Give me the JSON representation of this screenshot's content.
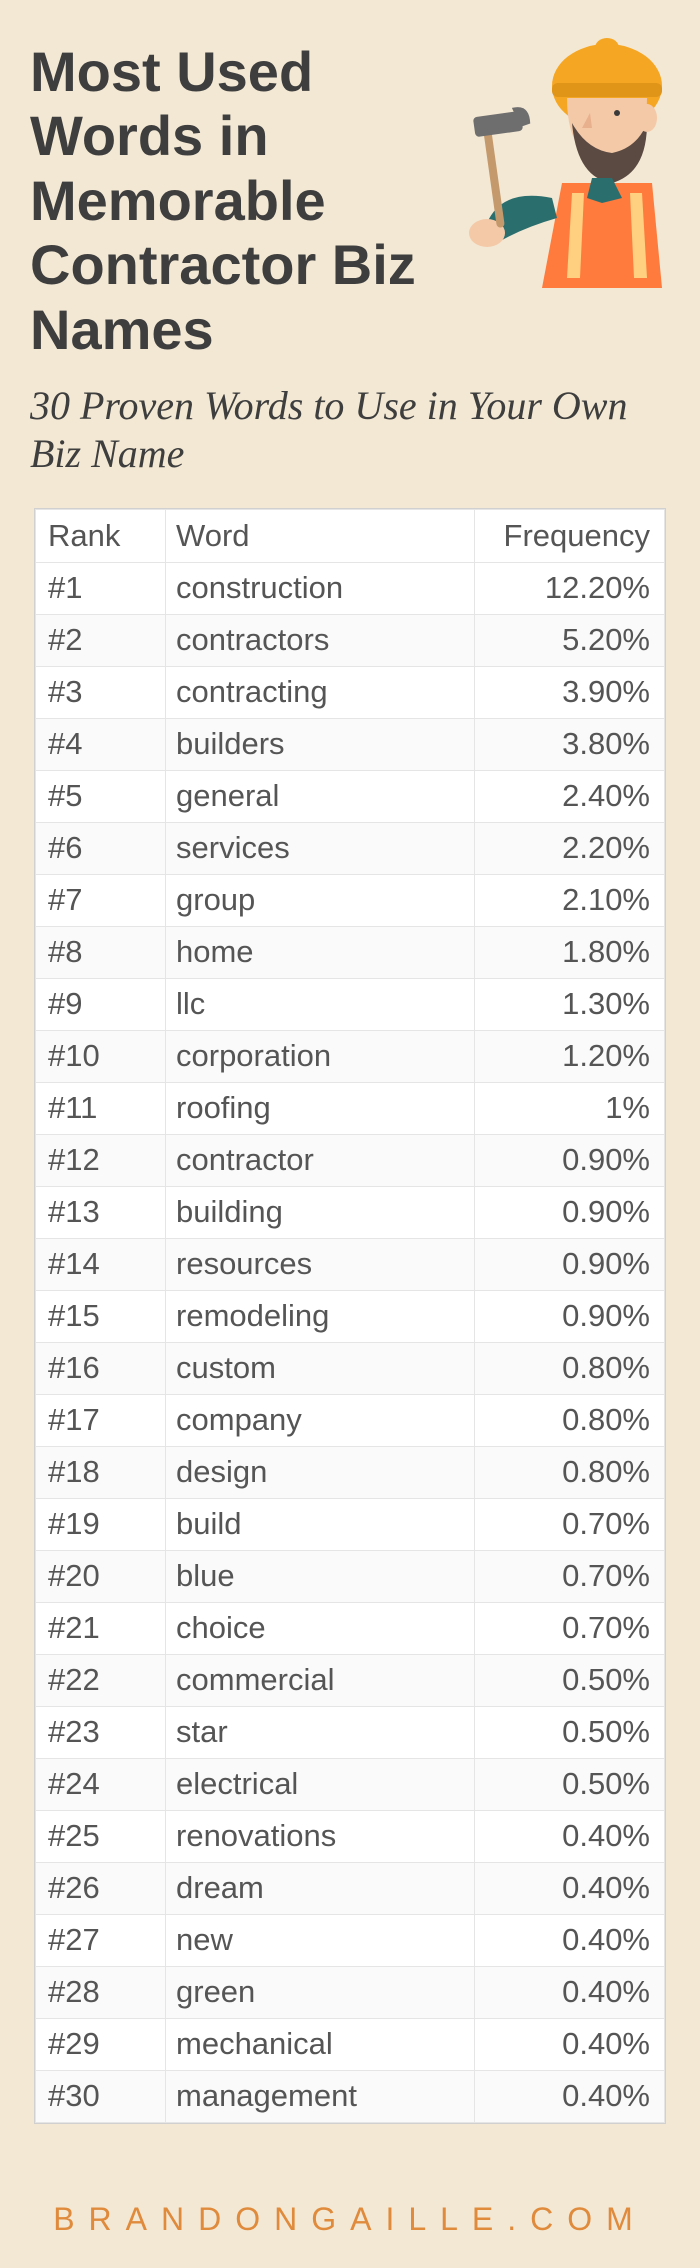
{
  "header": {
    "title": "Most Used Words in Memorable Contractor Biz Names",
    "subtitle": "30 Proven Words to Use in Your Own Biz Name"
  },
  "chart_data": {
    "type": "table",
    "columns": [
      "Rank",
      "Word",
      "Frequency"
    ],
    "rows": [
      {
        "rank": "#1",
        "word": "construction",
        "frequency": "12.20%"
      },
      {
        "rank": "#2",
        "word": "contractors",
        "frequency": "5.20%"
      },
      {
        "rank": "#3",
        "word": "contracting",
        "frequency": "3.90%"
      },
      {
        "rank": "#4",
        "word": "builders",
        "frequency": "3.80%"
      },
      {
        "rank": "#5",
        "word": "general",
        "frequency": "2.40%"
      },
      {
        "rank": "#6",
        "word": "services",
        "frequency": "2.20%"
      },
      {
        "rank": "#7",
        "word": "group",
        "frequency": "2.10%"
      },
      {
        "rank": "#8",
        "word": "home",
        "frequency": "1.80%"
      },
      {
        "rank": "#9",
        "word": "llc",
        "frequency": "1.30%"
      },
      {
        "rank": "#10",
        "word": "corporation",
        "frequency": "1.20%"
      },
      {
        "rank": "#11",
        "word": "roofing",
        "frequency": "1%"
      },
      {
        "rank": "#12",
        "word": "contractor",
        "frequency": "0.90%"
      },
      {
        "rank": "#13",
        "word": "building",
        "frequency": "0.90%"
      },
      {
        "rank": "#14",
        "word": "resources",
        "frequency": "0.90%"
      },
      {
        "rank": "#15",
        "word": "remodeling",
        "frequency": "0.90%"
      },
      {
        "rank": "#16",
        "word": "custom",
        "frequency": "0.80%"
      },
      {
        "rank": "#17",
        "word": "company",
        "frequency": "0.80%"
      },
      {
        "rank": "#18",
        "word": "design",
        "frequency": "0.80%"
      },
      {
        "rank": "#19",
        "word": "build",
        "frequency": "0.70%"
      },
      {
        "rank": "#20",
        "word": "blue",
        "frequency": "0.70%"
      },
      {
        "rank": "#21",
        "word": "choice",
        "frequency": "0.70%"
      },
      {
        "rank": "#22",
        "word": "commercial",
        "frequency": "0.50%"
      },
      {
        "rank": "#23",
        "word": "star",
        "frequency": "0.50%"
      },
      {
        "rank": "#24",
        "word": "electrical",
        "frequency": "0.50%"
      },
      {
        "rank": "#25",
        "word": "renovations",
        "frequency": "0.40%"
      },
      {
        "rank": "#26",
        "word": "dream",
        "frequency": "0.40%"
      },
      {
        "rank": "#27",
        "word": "new",
        "frequency": "0.40%"
      },
      {
        "rank": "#28",
        "word": "green",
        "frequency": "0.40%"
      },
      {
        "rank": "#29",
        "word": "mechanical",
        "frequency": "0.40%"
      },
      {
        "rank": "#30",
        "word": "management",
        "frequency": "0.40%"
      }
    ]
  },
  "footer": {
    "text": "BRANDONGAILLE.COM"
  }
}
